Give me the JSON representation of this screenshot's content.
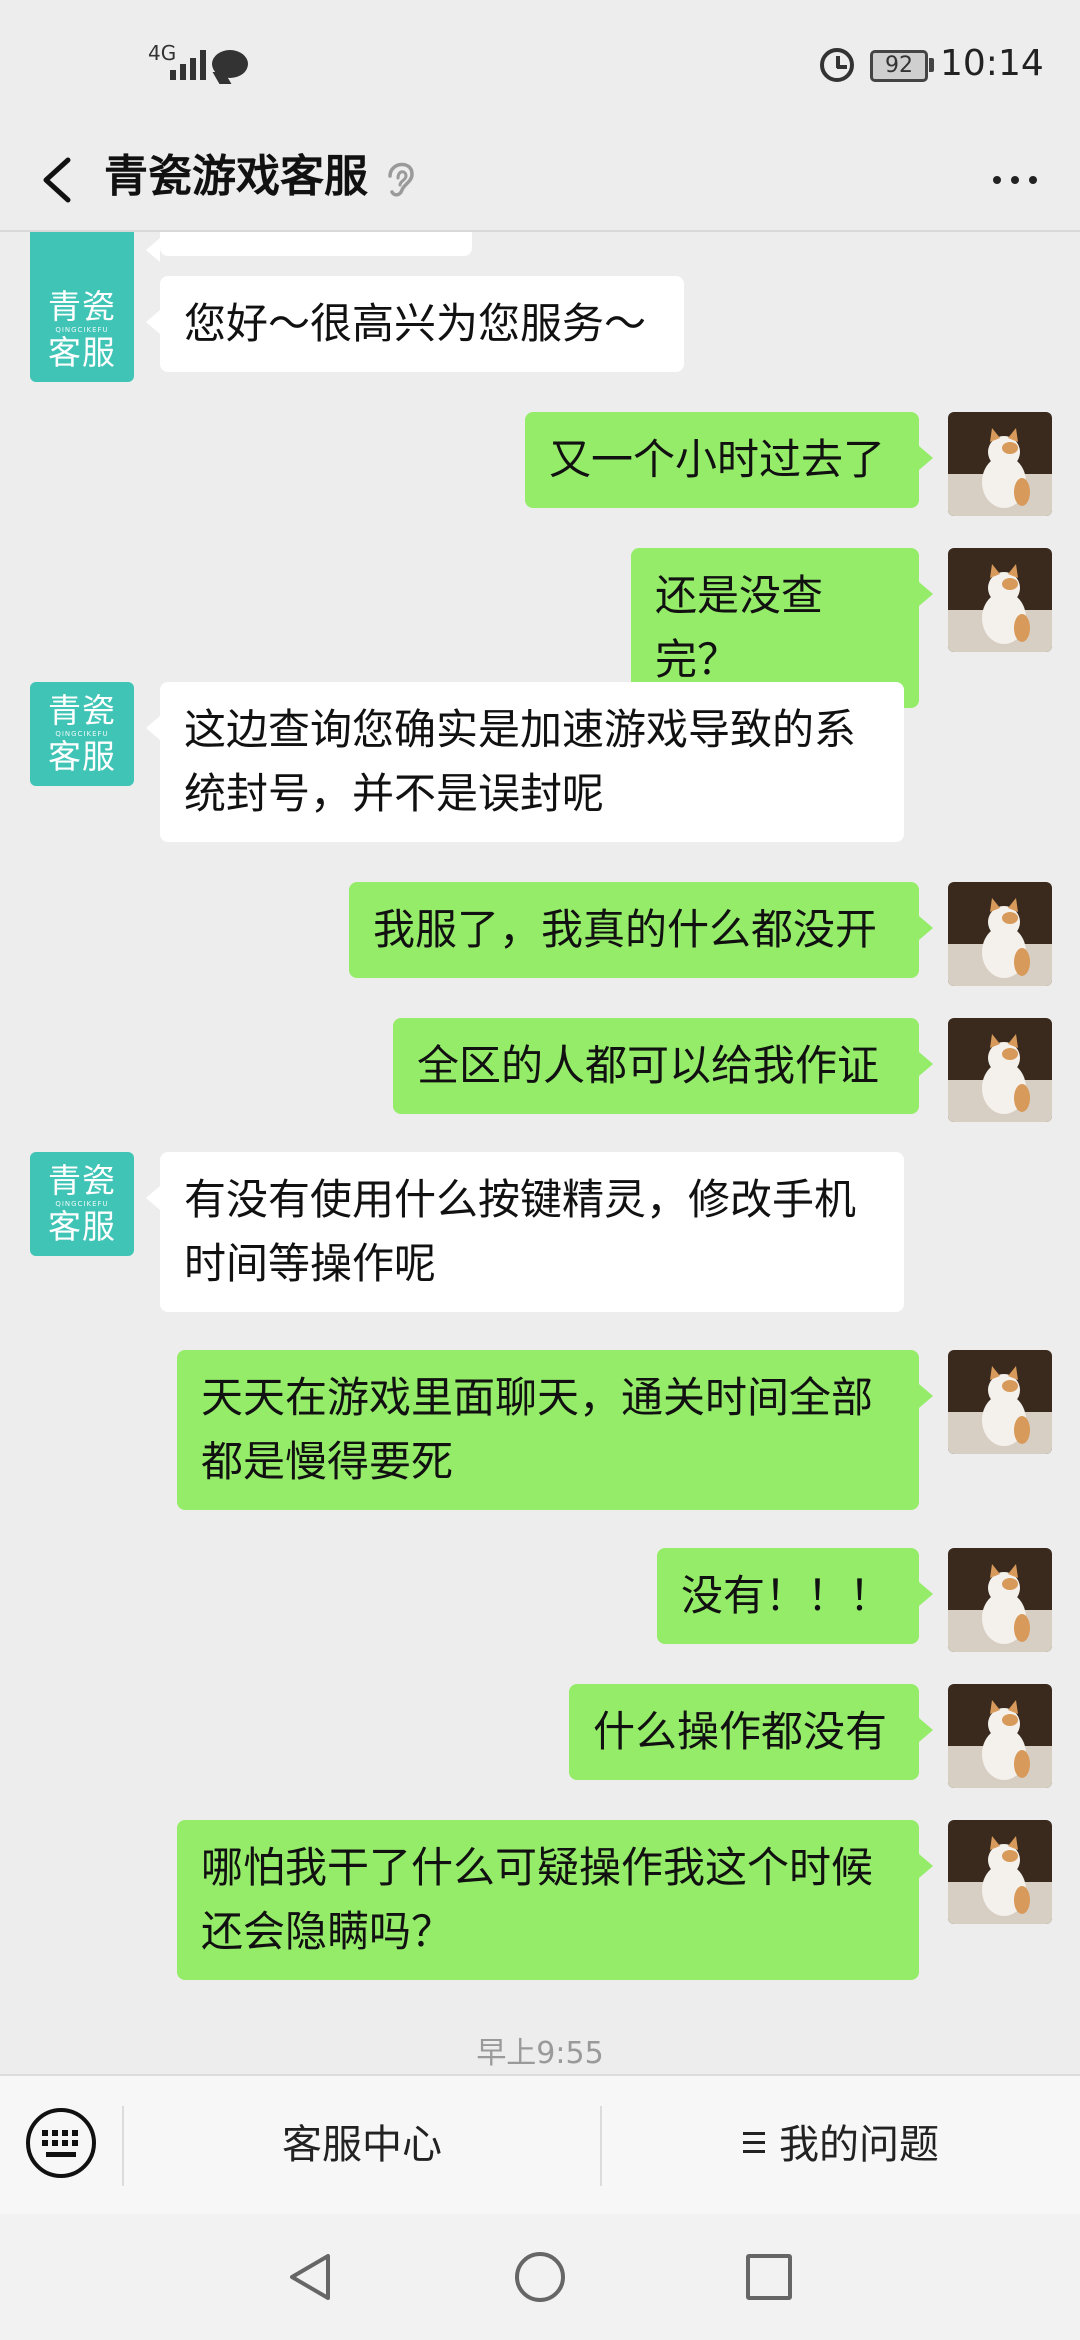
{
  "status_bar": {
    "network": "4G",
    "battery": "92",
    "time": "10:14"
  },
  "header": {
    "title": "青瓷游戏客服",
    "back_icon": "back-arrow-icon",
    "ear_icon": "ear-icon",
    "more_icon": "more-dots-icon"
  },
  "cs_avatar": {
    "line1": "青瓷",
    "line2": "客服",
    "mid": "QINGCIKEFU"
  },
  "messages": [
    {
      "from": "cs",
      "text": "您好～很高兴为您服务～"
    },
    {
      "from": "me",
      "text": "又一个小时过去了"
    },
    {
      "from": "me",
      "text": "还是没查完？"
    },
    {
      "from": "cs",
      "text": "这边查询您确实是加速游戏导致的系统封号，并不是误封呢"
    },
    {
      "from": "me",
      "text": "我服了，我真的什么都没开"
    },
    {
      "from": "me",
      "text": "全区的人都可以给我作证"
    },
    {
      "from": "cs",
      "text": "有没有使用什么按键精灵，修改手机时间等操作呢"
    },
    {
      "from": "me",
      "text": "天天在游戏里面聊天，通关时间全部都是慢得要死"
    },
    {
      "from": "me",
      "text": "没有！！！"
    },
    {
      "from": "me",
      "text": "什么操作都没有"
    },
    {
      "from": "me",
      "text": "哪怕我干了什么可疑操作我这个时候还会隐瞒吗？"
    }
  ],
  "timestamp": "早上9:55",
  "bottom_menu": {
    "keyboard_icon": "keyboard-icon",
    "item1": "客服中心",
    "item2": "我的问题"
  },
  "colors": {
    "background": "#ededed",
    "my_bubble": "#95ec69",
    "cs_bubble": "#ffffff",
    "cs_avatar": "#3fc4b6"
  }
}
